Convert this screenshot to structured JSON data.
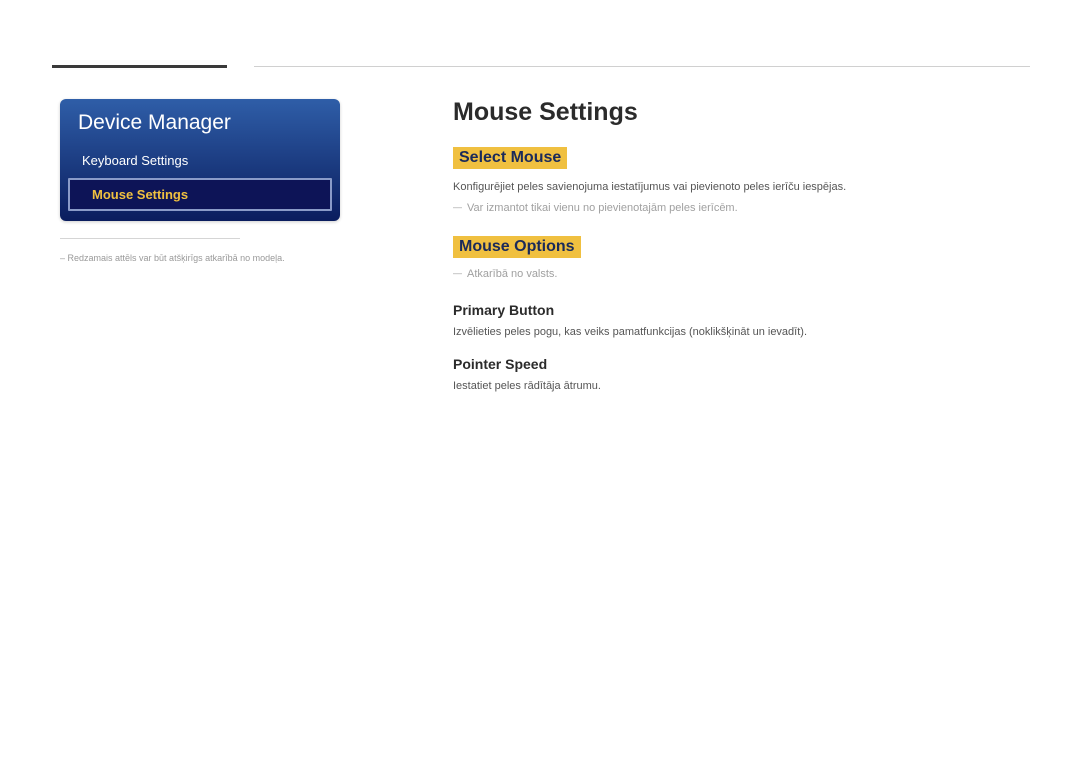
{
  "sidebar": {
    "title": "Device Manager",
    "items": [
      {
        "label": "Keyboard Settings",
        "selected": false
      },
      {
        "label": "Mouse Settings",
        "selected": true
      }
    ],
    "footnote": "Redzamais attēls var būt atšķirīgs atkarībā no modeļa."
  },
  "main": {
    "title": "Mouse Settings",
    "sections": [
      {
        "heading": "Select Mouse",
        "body": "Konfigurējiet peles savienojuma iestatījumus vai pievienoto peles ierīču iespējas.",
        "note": "Var izmantot tikai vienu no pievienotajām peles ierīcēm."
      },
      {
        "heading": "Mouse Options",
        "note": "Atkarībā no valsts.",
        "subsections": [
          {
            "heading": "Primary Button",
            "body": "Izvēlieties peles pogu, kas veiks pamatfunkcijas (noklikšķināt un ievadīt)."
          },
          {
            "heading": "Pointer Speed",
            "body": "Iestatiet peles rādītāja ātrumu."
          }
        ]
      }
    ]
  }
}
